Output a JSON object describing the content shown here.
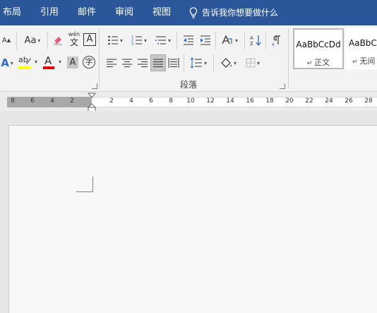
{
  "menubar": {
    "items": [
      {
        "label": "布局"
      },
      {
        "label": "引用"
      },
      {
        "label": "邮件"
      },
      {
        "label": "审阅"
      },
      {
        "label": "视图"
      }
    ],
    "tell_me": "告诉我你想要做什么",
    "bg_color": "#2b579a"
  },
  "ribbon": {
    "font_group": {
      "change_case": "Aa",
      "phonetic_top": "wén",
      "phonetic_bottom": "文",
      "char_border": "A",
      "text_effects": "A",
      "highlight": "ab",
      "font_color": "A",
      "char_shading": "A",
      "enclose_char": "字",
      "grow_font": "A"
    },
    "paragraph_group": {
      "label": "段落"
    },
    "styles": [
      {
        "sample": "AaBbCcDd",
        "name": "正文"
      },
      {
        "sample": "AaBbC",
        "name": "无间"
      }
    ],
    "colors": {
      "highlight_bar": "#ffff00",
      "font_color_bar": "#e00000"
    }
  },
  "ruler": {
    "left_labels": [
      "8",
      "6",
      "4",
      "2"
    ],
    "right_labels": [
      "2",
      "4",
      "6",
      "8",
      "10",
      "12",
      "14",
      "16",
      "18",
      "20",
      "22",
      "24",
      "26",
      "28"
    ]
  }
}
